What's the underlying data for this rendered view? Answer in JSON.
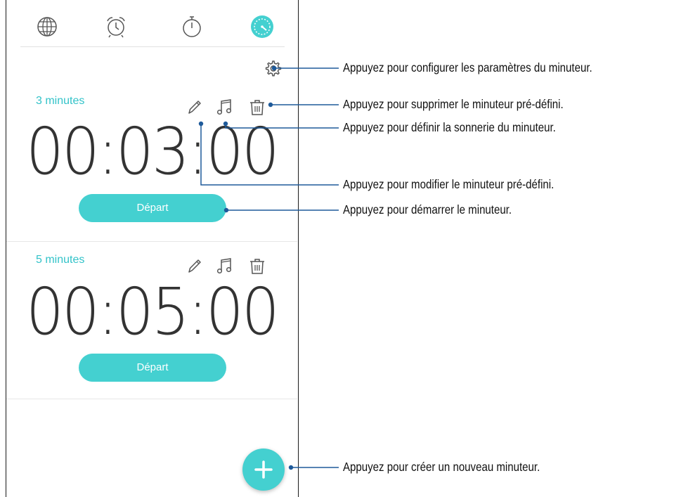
{
  "tabs": [
    {
      "icon": "globe-icon",
      "label": "World clock"
    },
    {
      "icon": "alarm-clock-icon",
      "label": "Alarm"
    },
    {
      "icon": "stopwatch-icon",
      "label": "Stopwatch"
    },
    {
      "icon": "timer-icon",
      "label": "Timer",
      "active": true
    }
  ],
  "timers": [
    {
      "label": "3 minutes",
      "time": "00:03:00",
      "start_label": "Départ"
    },
    {
      "label": "5 minutes",
      "time": "00:05:00",
      "start_label": "Départ"
    }
  ],
  "annotations": {
    "settings": "Appuyez pour configurer les paramètres du minuteur.",
    "delete": "Appuyez pour supprimer le minuteur pré-défini.",
    "ringtone": "Appuyez pour définir la sonnerie du minuteur.",
    "edit": "Appuyez pour modifier le minuteur pré-défini.",
    "start": "Appuyez pour démarrer le minuteur.",
    "create": "Appuyez pour créer un nouveau minuteur."
  },
  "colors": {
    "accent": "#44d0d0",
    "label_accent": "#33c3c9",
    "callout_line": "#1e5a9a"
  }
}
